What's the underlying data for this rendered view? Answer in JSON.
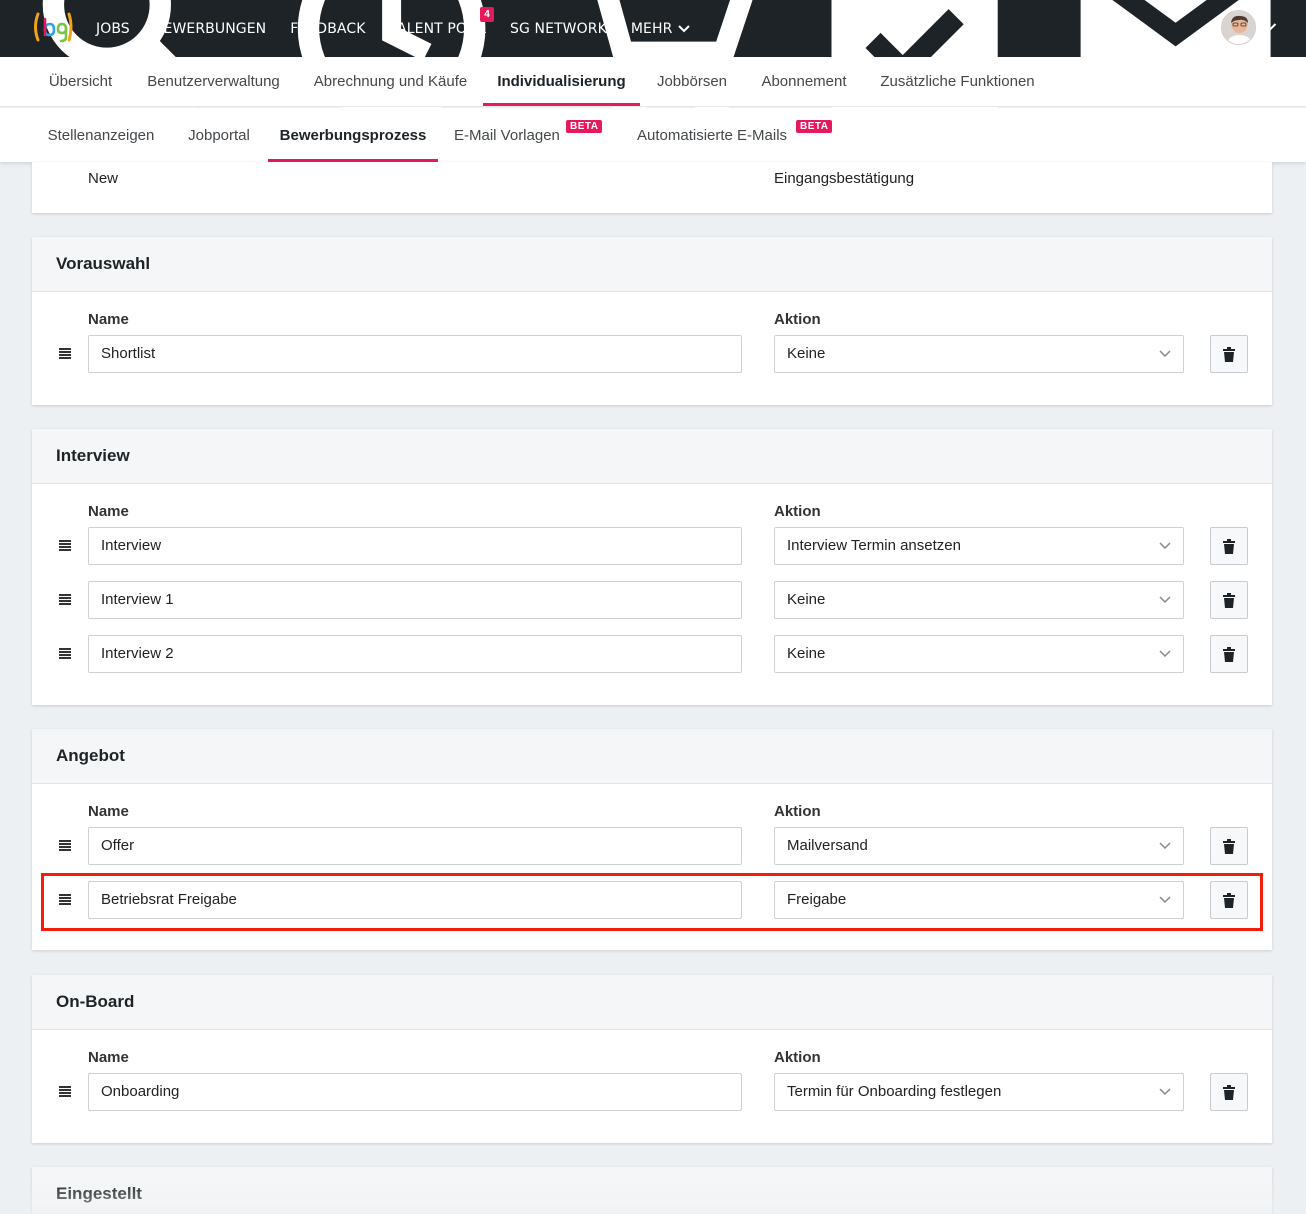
{
  "topnav": {
    "items": [
      "JOBS",
      "BEWERBUNGEN",
      "FEEDBACK",
      "TALENT POOL",
      "SG NETWORK",
      "MEHR"
    ],
    "talent_pool_badge": "4",
    "icons": [
      "search-icon",
      "clock-icon",
      "cart-icon",
      "task-check-icon",
      "mail-icon"
    ]
  },
  "tabs_primary": [
    "Übersicht",
    "Benutzerverwaltung",
    "Abrechnung und Käufe",
    "Individualisierung",
    "Jobbörsen",
    "Abonnement",
    "Zusätzliche Funktionen"
  ],
  "tabs_primary_active": "Individualisierung",
  "tabs_secondary": [
    "Stellenanzeigen",
    "Jobportal",
    "Bewerbungsprozess",
    "E-Mail Vorlagen",
    "Automatisierte E-Mails"
  ],
  "tabs_secondary_active": "Bewerbungsprozess",
  "beta_label": "BETA",
  "top_partial": {
    "name": "New",
    "action": "Eingangsbestätigung"
  },
  "col_name": "Name",
  "col_action": "Aktion",
  "sections": [
    {
      "title": "Vorauswahl",
      "rows": [
        {
          "name": "Shortlist",
          "action": "Keine"
        }
      ]
    },
    {
      "title": "Interview",
      "rows": [
        {
          "name": "Interview",
          "action": "Interview Termin ansetzen"
        },
        {
          "name": "Interview 1",
          "action": "Keine"
        },
        {
          "name": "Interview 2",
          "action": "Keine"
        }
      ]
    },
    {
      "title": "Angebot",
      "rows": [
        {
          "name": "Offer",
          "action": "Mailversand"
        },
        {
          "name": "Betriebsrat Freigabe",
          "action": "Freigabe"
        }
      ]
    },
    {
      "title": "On-Board",
      "rows": [
        {
          "name": "Onboarding",
          "action": "Termin für Onboarding festlegen"
        }
      ]
    },
    {
      "title": "Eingestellt",
      "rows": []
    }
  ],
  "colors": {
    "accent": "#e6195e",
    "navbar": "#1d2326",
    "highlight": "#f21d0b"
  }
}
